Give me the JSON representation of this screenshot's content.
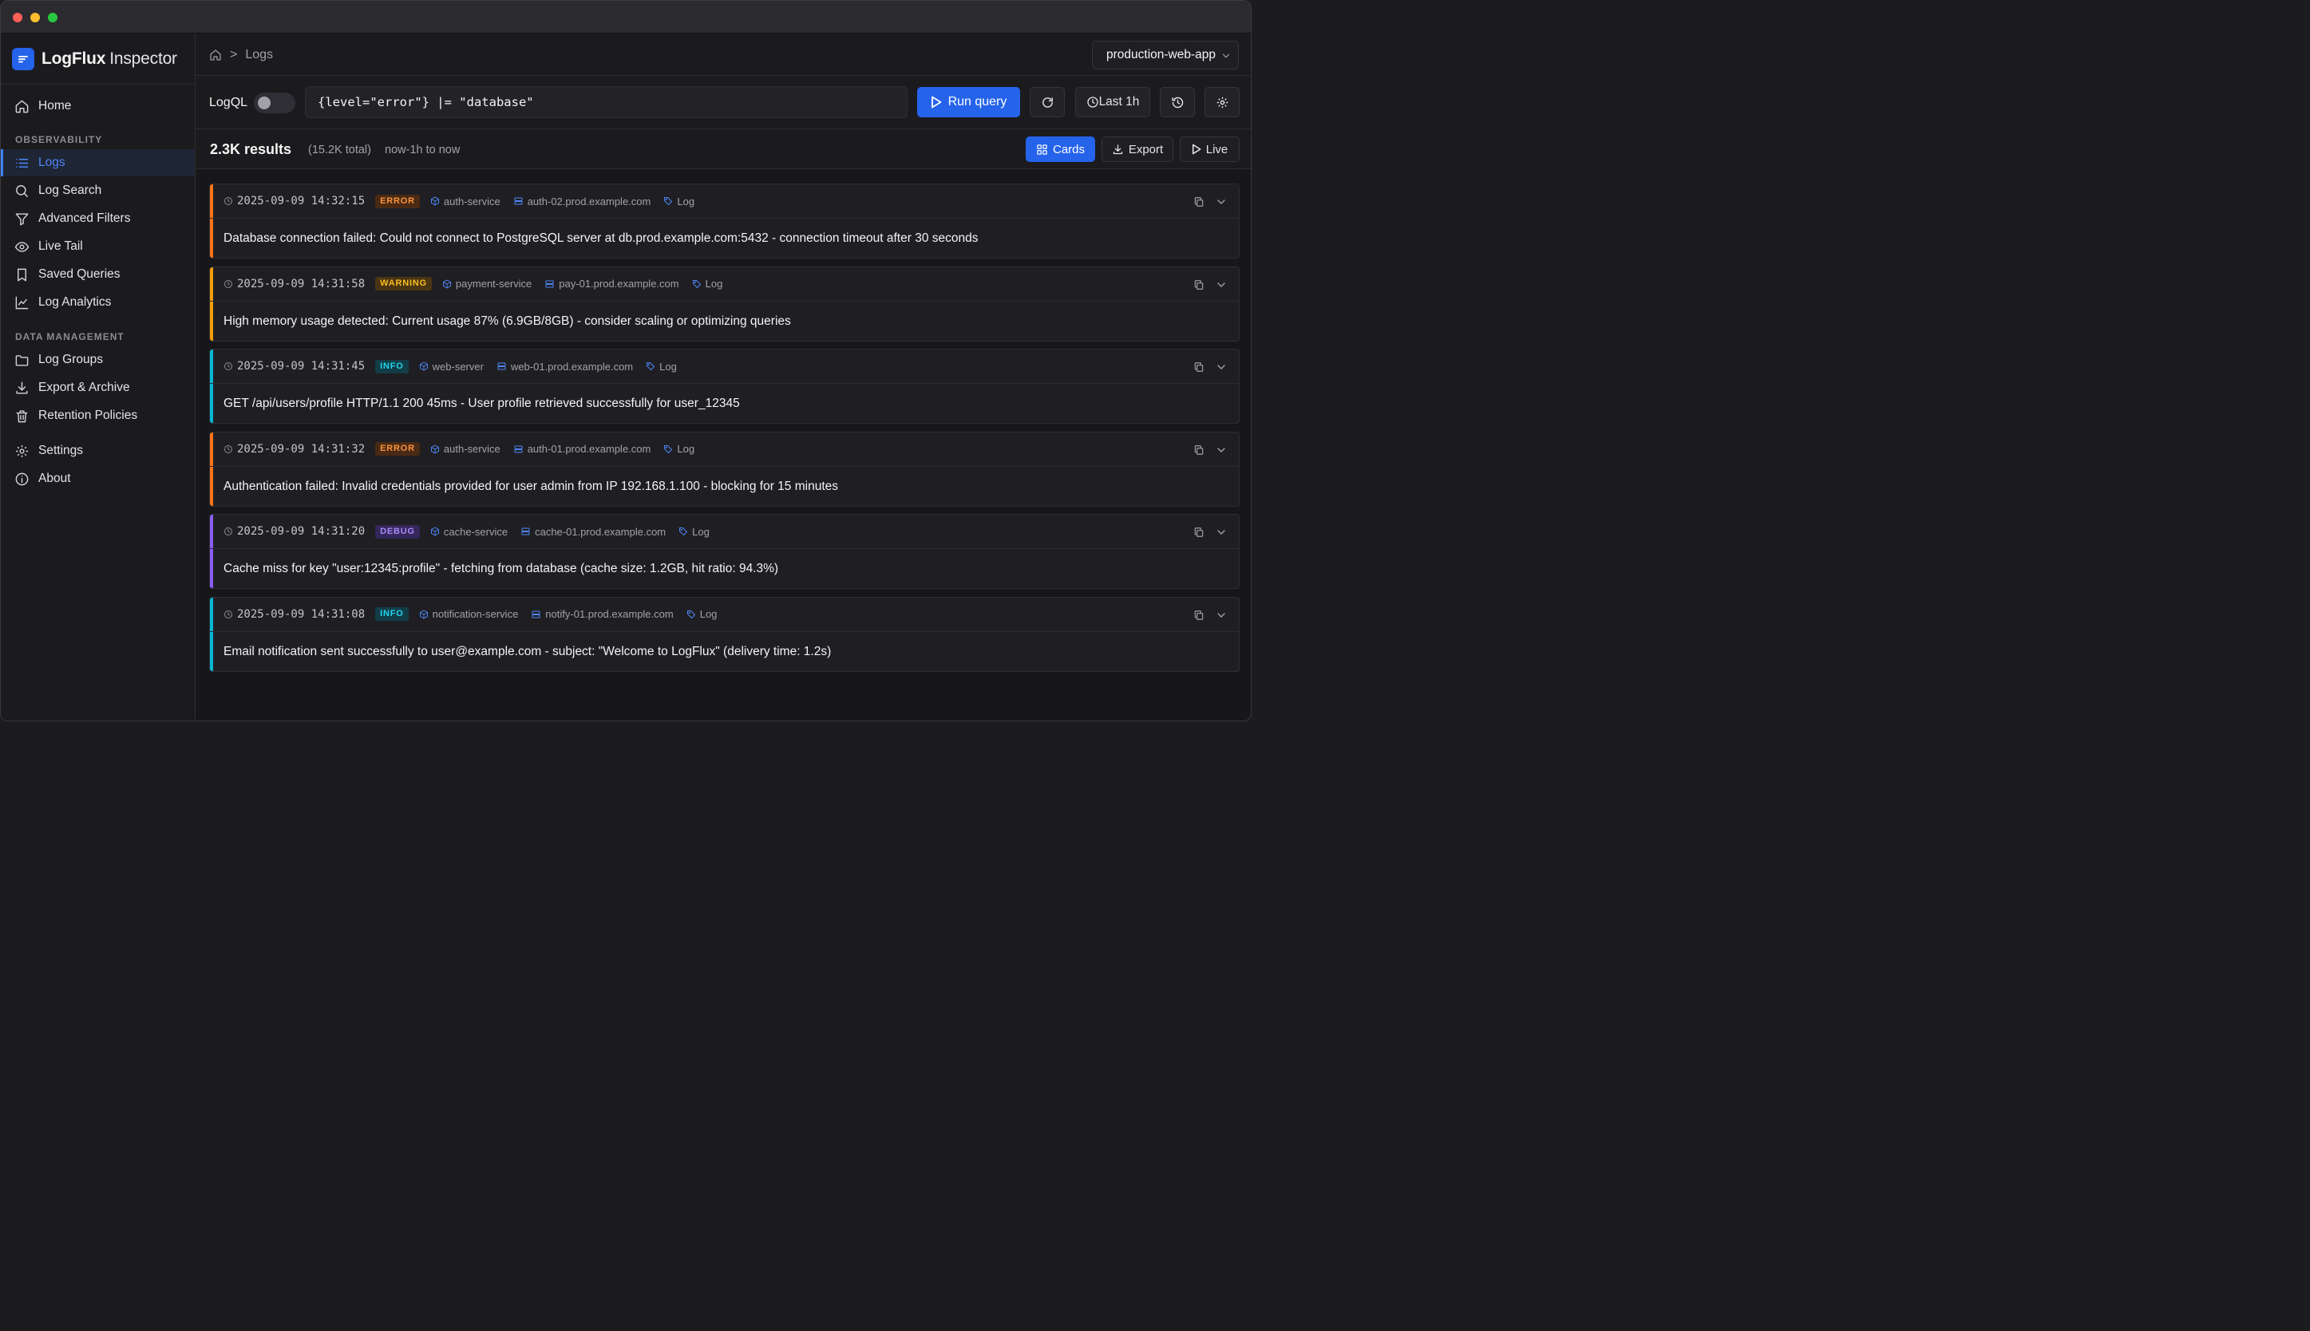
{
  "app": {
    "brand_name": "LogFlux",
    "brand_sub": "Inspector"
  },
  "sidebar": {
    "home": "Home",
    "section_observability": "OBSERVABILITY",
    "observability": [
      {
        "label": "Logs",
        "icon": "list-icon",
        "active": true
      },
      {
        "label": "Log Search",
        "icon": "search-icon"
      },
      {
        "label": "Advanced Filters",
        "icon": "filter-icon"
      },
      {
        "label": "Live Tail",
        "icon": "eye-icon"
      },
      {
        "label": "Saved Queries",
        "icon": "bookmark-icon"
      },
      {
        "label": "Log Analytics",
        "icon": "chart-line-icon"
      }
    ],
    "section_data": "DATA MANAGEMENT",
    "data_management": [
      {
        "label": "Log Groups",
        "icon": "folder-icon"
      },
      {
        "label": "Export & Archive",
        "icon": "download-icon"
      },
      {
        "label": "Retention Policies",
        "icon": "trash-icon"
      }
    ],
    "settings": "Settings",
    "about": "About"
  },
  "topbar": {
    "breadcrumb_sep": ">",
    "breadcrumb_current": "Logs",
    "environment": "production-web-app"
  },
  "query": {
    "label": "LogQL",
    "toggle_on": false,
    "value": "{level=\"error\"} |= \"database\"",
    "run_label": "Run query",
    "time_range": "Last 1h"
  },
  "results": {
    "count": "2.3K results",
    "total": "(15.2K total)",
    "range": "now-1h to now",
    "view_cards": "Cards",
    "export": "Export",
    "live": "Live"
  },
  "colors": {
    "accent": "#2563eb",
    "error": "#f97316",
    "warning": "#f59e0b",
    "info": "#06b6d4",
    "debug": "#8b5cf6"
  },
  "logs": [
    {
      "timestamp": "2025-09-09 14:32:15",
      "level": "ERROR",
      "service": "auth-service",
      "host": "auth-02.prod.example.com",
      "tag": "Log",
      "message": "Database connection failed: Could not connect to PostgreSQL server at db.prod.example.com:5432 - connection timeout after 30 seconds"
    },
    {
      "timestamp": "2025-09-09 14:31:58",
      "level": "WARNING",
      "service": "payment-service",
      "host": "pay-01.prod.example.com",
      "tag": "Log",
      "message": "High memory usage detected: Current usage 87% (6.9GB/8GB) - consider scaling or optimizing queries"
    },
    {
      "timestamp": "2025-09-09 14:31:45",
      "level": "INFO",
      "service": "web-server",
      "host": "web-01.prod.example.com",
      "tag": "Log",
      "message": "GET /api/users/profile HTTP/1.1 200 45ms - User profile retrieved successfully for user_12345"
    },
    {
      "timestamp": "2025-09-09 14:31:32",
      "level": "ERROR",
      "service": "auth-service",
      "host": "auth-01.prod.example.com",
      "tag": "Log",
      "message": "Authentication failed: Invalid credentials provided for user admin from IP 192.168.1.100 - blocking for 15 minutes"
    },
    {
      "timestamp": "2025-09-09 14:31:20",
      "level": "DEBUG",
      "service": "cache-service",
      "host": "cache-01.prod.example.com",
      "tag": "Log",
      "message": "Cache miss for key \"user:12345:profile\" - fetching from database (cache size: 1.2GB, hit ratio: 94.3%)"
    },
    {
      "timestamp": "2025-09-09 14:31:08",
      "level": "INFO",
      "service": "notification-service",
      "host": "notify-01.prod.example.com",
      "tag": "Log",
      "message": "Email notification sent successfully to user@example.com - subject: \"Welcome to LogFlux\" (delivery time: 1.2s)"
    }
  ]
}
